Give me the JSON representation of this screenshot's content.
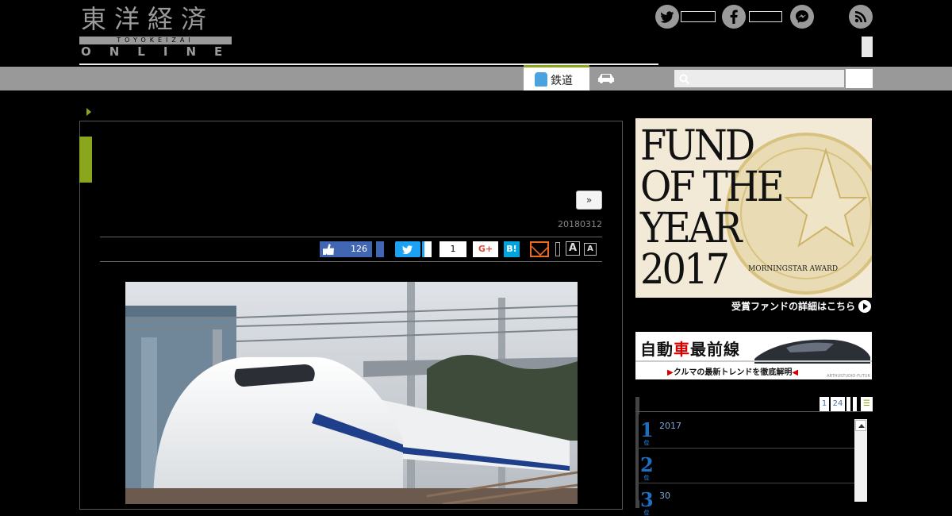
{
  "header": {
    "logo_kanji": "東洋経済",
    "logo_romaji": "TOYOKEIZAI",
    "logo_online": "ONLINE",
    "social_icons": [
      "twitter-icon",
      "facebook-icon",
      "messenger-icon",
      "rss-icon"
    ]
  },
  "nav": {
    "tabs": [
      {
        "label": "鉄道",
        "icon": "train-icon",
        "active": true
      },
      {
        "label": "",
        "icon": "car-icon",
        "active": false
      }
    ],
    "search": {
      "placeholder": "",
      "value": ""
    }
  },
  "article": {
    "next_label": "»",
    "date": "20180312",
    "share": {
      "facebook_count": "126",
      "pocket_count": "1",
      "gplus_label": "G+",
      "hatena_label": "B!",
      "font_large": "A",
      "font_small": "A"
    }
  },
  "sidebar": {
    "fund_banner": {
      "line1": "FUND",
      "line2": "OF THE",
      "line3": "YEAR",
      "line4": "2017",
      "award": "MORNINGSTAR AWARD",
      "link": "受賞ファンドの詳細はこちら"
    },
    "car_banner": {
      "title_a": "自動",
      "title_b": "車",
      "title_c": "最前線",
      "sub": "クルマの最新トレンドを徹底解明",
      "credit": "ARTHUSTUDIO-FUTUR"
    },
    "ranking": {
      "tabs": [
        "1",
        "24"
      ],
      "items": [
        {
          "rank": "1",
          "unit": "位",
          "text": "2017"
        },
        {
          "rank": "2",
          "unit": "位",
          "text": ""
        },
        {
          "rank": "3",
          "unit": "位",
          "text": "30"
        }
      ]
    }
  },
  "colors": {
    "accent": "#8aa61c",
    "nav_bg": "#999999",
    "facebook": "#4267b2",
    "twitter": "#1da1f2"
  }
}
